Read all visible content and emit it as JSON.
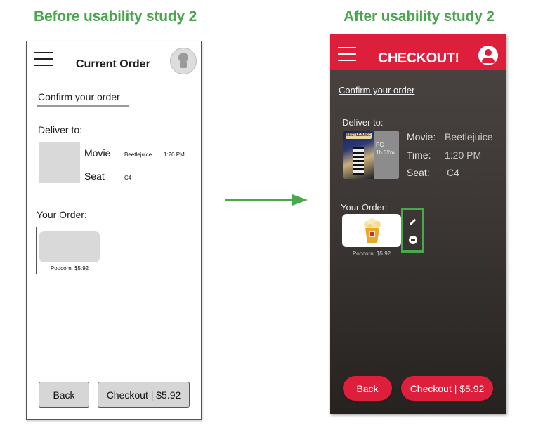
{
  "headings": {
    "before": "Before usability study 2",
    "after": "After usability study 2"
  },
  "colors": {
    "heading": "#4aa64e",
    "brand_red": "#de1f3c",
    "highlight_green": "#47a94c"
  },
  "before": {
    "header": {
      "title": "Current Order"
    },
    "confirm_link": "Confirm your order",
    "deliver_label": "Deliver to:",
    "movie_label": "Movie",
    "movie_value": "Beetlejuice",
    "time_value": "1:20 PM",
    "seat_label": "Seat",
    "seat_value": "C4",
    "your_order_label": "Your Order:",
    "item_caption": "Popcorn: $5.92",
    "back_button": "Back",
    "checkout_button": "Checkout | $5.92"
  },
  "after": {
    "header": {
      "title": "CHECKOUT!"
    },
    "confirm_link": "Confirm your order",
    "deliver_label": "Deliver to:",
    "poster": {
      "logo": "BEETLEJUICE",
      "rating": "PG",
      "runtime": "1h 32m"
    },
    "movie_label": "Movie:",
    "movie_value": "Beetlejuice",
    "time_label": "Time:",
    "time_value": "1:20 PM",
    "seat_label": "Seat:",
    "seat_value": "C4",
    "your_order_label": "Your Order:",
    "item_caption": "Popcorn: $5.92",
    "icons": [
      "pencil-icon",
      "minus-circle-icon",
      "menu-icon",
      "account-icon",
      "popcorn-icon"
    ],
    "back_button": "Back",
    "checkout_button": "Checkout | $5.92"
  }
}
